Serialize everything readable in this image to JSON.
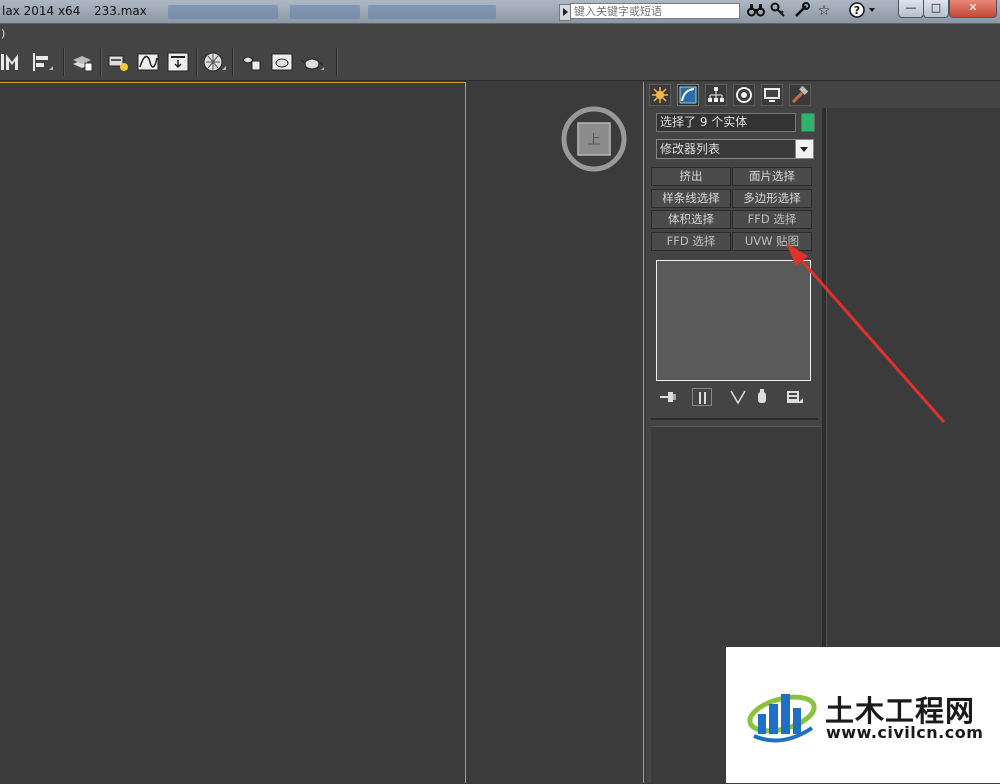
{
  "titlebar": {
    "app_title": "lax  2014 x64",
    "file_title": "233.max",
    "search_placeholder": "键入关键字或短语",
    "icons": [
      "binoculars-icon",
      "key-icon",
      "tools-icon",
      "star-icon",
      "help-icon"
    ],
    "window_buttons": {
      "minimize": "—",
      "maximize": "□",
      "close": "✕"
    }
  },
  "menu": {
    "fragment": ")"
  },
  "command_panel": {
    "tabs": [
      "create-tab",
      "modify-tab",
      "hierarchy-tab",
      "motion-tab",
      "display-tab",
      "utilities-tab"
    ],
    "active_tab": "modify-tab",
    "selection_text": "选择了 9 个实体",
    "selection_color": "#2fb26a",
    "modifier_list": "修改器列表",
    "modifier_buttons": [
      {
        "label": "挤出"
      },
      {
        "label": "面片选择"
      },
      {
        "label": "样条线选择"
      },
      {
        "label": "多边形选择"
      },
      {
        "label": "体积选择"
      },
      {
        "label": "FFD 选择"
      },
      {
        "label": "FFD 选择"
      },
      {
        "label": "UVW 贴图"
      }
    ]
  },
  "viewcube": {
    "face_label": "上"
  },
  "annotation": {
    "arrow_color": "#e0312c",
    "target": "UVW 贴图"
  },
  "watermark": {
    "title": "土木工程网",
    "url": "www.civilcn.com"
  }
}
